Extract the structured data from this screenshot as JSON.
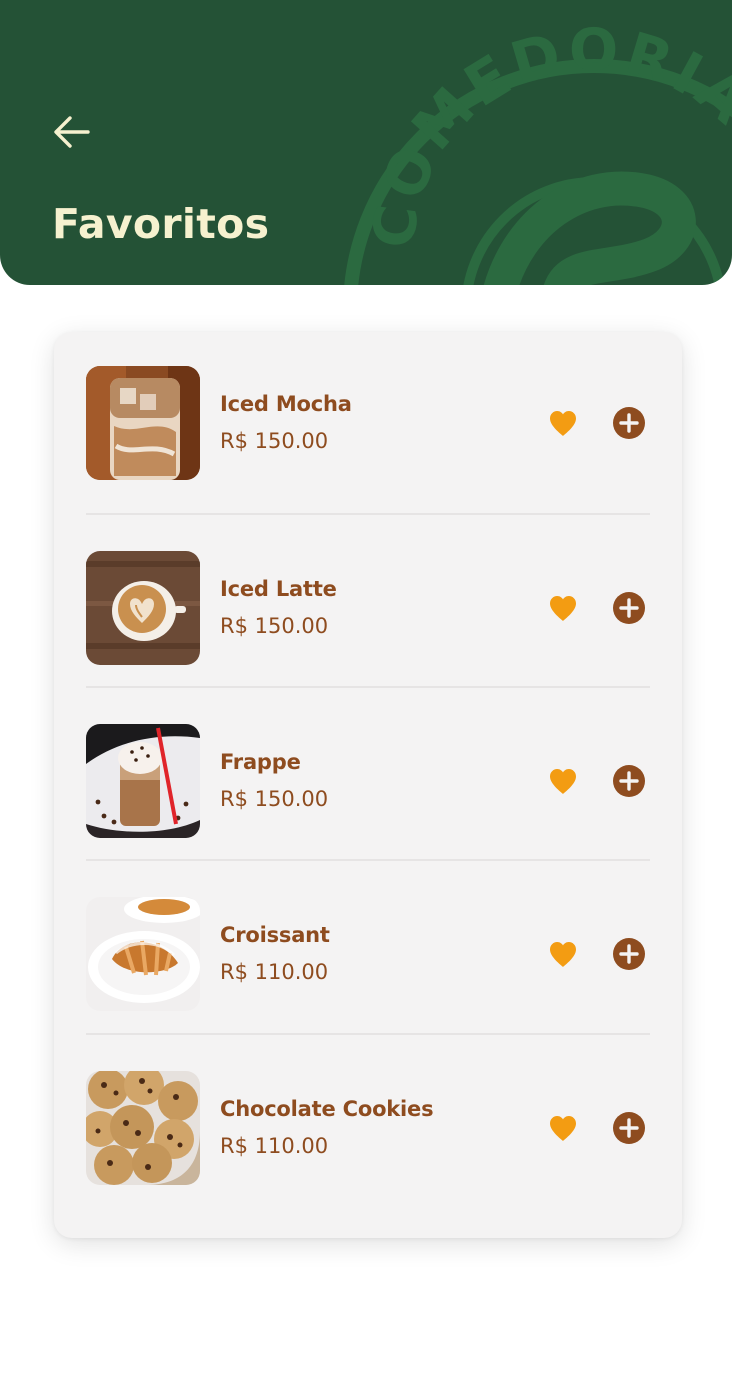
{
  "header": {
    "title": "Favoritos",
    "seal_text": "COMEDORIA"
  },
  "colors": {
    "header_bg": "#245236",
    "title": "#f6f1cf",
    "item_text": "#8e4c1f",
    "heart": "#f39c12",
    "add_button": "#8e4c1f",
    "card_bg": "#f4f3f3"
  },
  "icons": {
    "back": "arrow-left-icon",
    "favorite": "heart-icon",
    "add": "plus-circle-icon"
  },
  "items": [
    {
      "name": "Iced Mocha",
      "price": "R$ 150.00"
    },
    {
      "name": "Iced Latte",
      "price": "R$ 150.00"
    },
    {
      "name": "Frappe",
      "price": "R$ 150.00"
    },
    {
      "name": "Croissant",
      "price": "R$ 110.00"
    },
    {
      "name": "Chocolate Cookies",
      "price": "R$ 110.00"
    }
  ]
}
